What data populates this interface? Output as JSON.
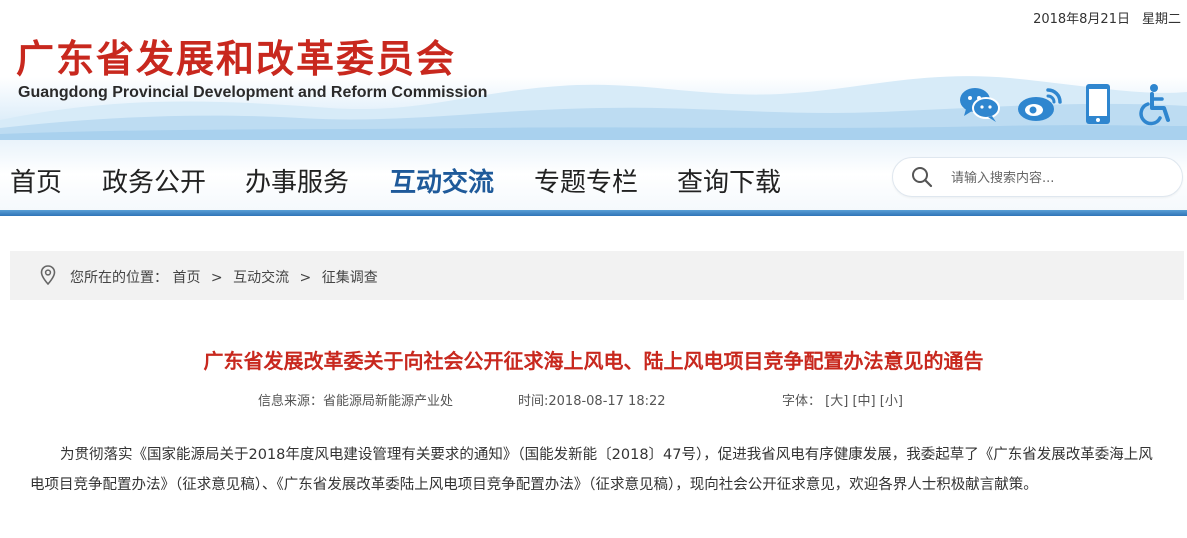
{
  "header": {
    "date": "2018年8月21日",
    "weekday": "星期二",
    "title_cn": "广东省发展和改革委员会",
    "title_en": "Guangdong Provincial Development and Reform Commission",
    "social_icons": [
      "wechat-icon",
      "weibo-icon",
      "mobile-icon",
      "accessibility-icon"
    ],
    "brand_red": "#c8281e",
    "nav_blue": "#2f74b8"
  },
  "nav": {
    "items": [
      {
        "label": "首页"
      },
      {
        "label": "政务公开"
      },
      {
        "label": "办事服务"
      },
      {
        "label": "互动交流",
        "active": true
      },
      {
        "label": "专题专栏"
      },
      {
        "label": "查询下载"
      }
    ],
    "search_placeholder": "请输入搜索内容..."
  },
  "breadcrumb": {
    "prefix": "您所在的位置：",
    "items": [
      "首页",
      "互动交流",
      "征集调查"
    ],
    "separator": ">"
  },
  "article": {
    "title": "广东省发展改革委关于向社会公开征求海上风电、陆上风电项目竞争配置办法意见的通告",
    "source": "信息来源：省能源局新能源产业处",
    "time": "时间:2018-08-17 18:22",
    "font_size_label": "字体：",
    "font_sizes": [
      "[大]",
      "[中]",
      "[小]"
    ],
    "body": "为贯彻落实《国家能源局关于2018年度风电建设管理有关要求的通知》（国能发新能〔2018〕47号），促进我省风电有序健康发展，我委起草了《广东省发展改革委海上风电项目竞争配置办法》（征求意见稿）、《广东省发展改革委陆上风电项目竞争配置办法》（征求意见稿），现向社会公开征求意见，欢迎各界人士积极献言献策。"
  }
}
